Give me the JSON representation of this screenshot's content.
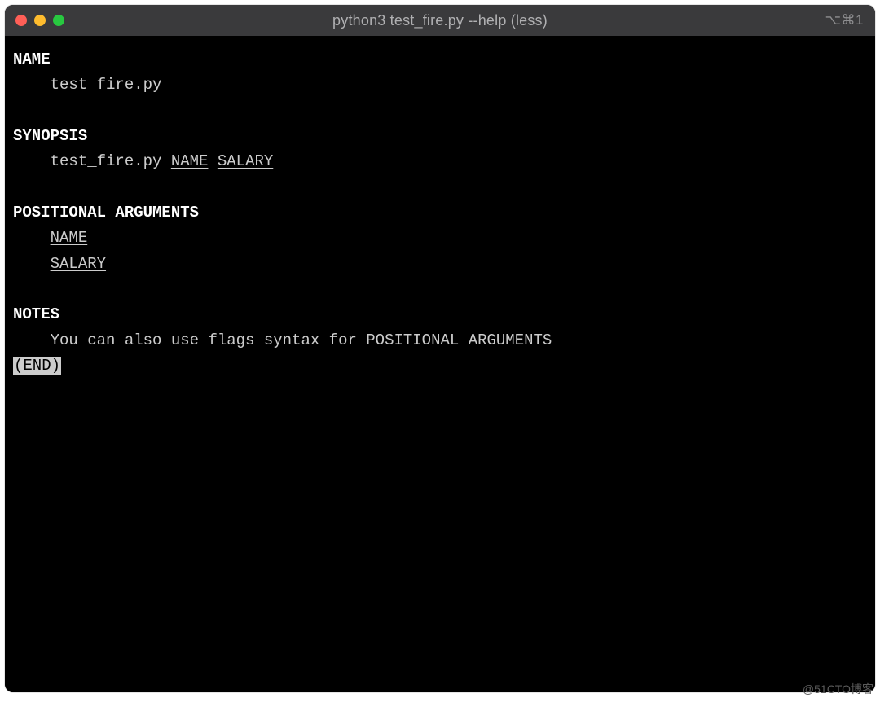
{
  "window": {
    "title": "python3 test_fire.py --help (less)",
    "shortcut": "⌥⌘1"
  },
  "man": {
    "name_header": "NAME",
    "name_value": "test_fire.py",
    "synopsis_header": "SYNOPSIS",
    "synopsis_cmd": "test_fire.py",
    "synopsis_arg1": "NAME",
    "synopsis_arg2": "SALARY",
    "posargs_header": "POSITIONAL ARGUMENTS",
    "posarg1": "NAME",
    "posarg2": "SALARY",
    "notes_header": "NOTES",
    "notes_body": "You can also use flags syntax for POSITIONAL ARGUMENTS",
    "end_marker": "(END)"
  },
  "watermark": "@51CTO博客"
}
